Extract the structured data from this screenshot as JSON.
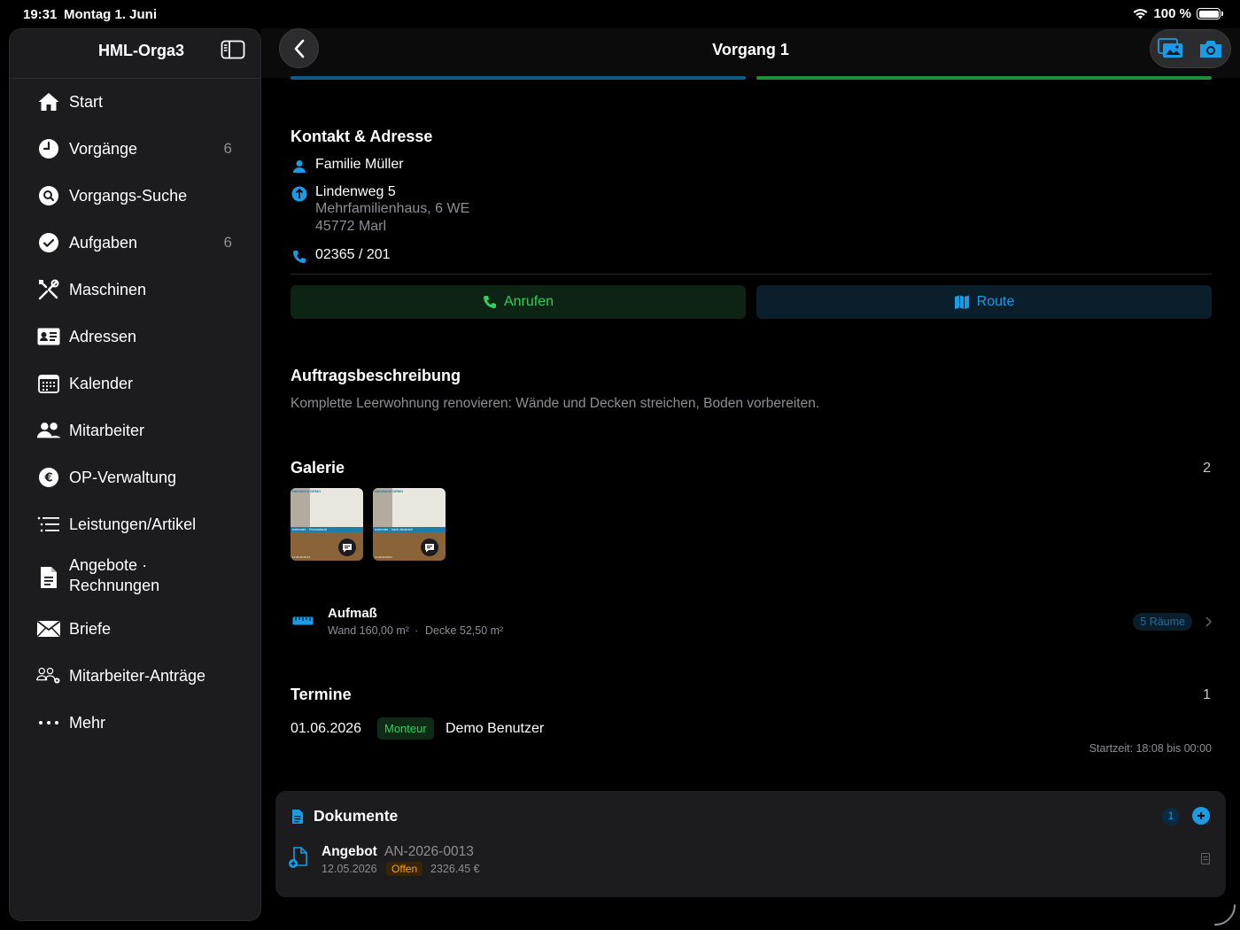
{
  "status": {
    "time": "19:31",
    "date": "Montag 1. Juni",
    "battery": "100 %"
  },
  "sidebar": {
    "title": "HML-Orga3",
    "items": [
      {
        "label": "Start",
        "icon": "house-icon",
        "count": ""
      },
      {
        "label": "Vorgänge",
        "icon": "clock-icon",
        "count": "6"
      },
      {
        "label": "Vorgangs-Suche",
        "icon": "search-icon",
        "count": ""
      },
      {
        "label": "Aufgaben",
        "icon": "checkmark-icon",
        "count": "6"
      },
      {
        "label": "Maschinen",
        "icon": "tools-icon",
        "count": ""
      },
      {
        "label": "Adressen",
        "icon": "contact-card-icon",
        "count": ""
      },
      {
        "label": "Kalender",
        "icon": "calendar-icon",
        "count": ""
      },
      {
        "label": "Mitarbeiter",
        "icon": "people-icon",
        "count": ""
      },
      {
        "label": "OP-Verwaltung",
        "icon": "euro-icon",
        "count": ""
      },
      {
        "label": "Leistungen/Artikel",
        "icon": "list-icon",
        "count": ""
      },
      {
        "label": "Angebote ·",
        "label2": "Rechnungen",
        "icon": "document-icon",
        "count": ""
      },
      {
        "label": "Briefe",
        "icon": "envelope-icon",
        "count": ""
      },
      {
        "label": "Mitarbeiter-Anträge",
        "icon": "people-gear-icon",
        "count": ""
      },
      {
        "label": "Mehr",
        "icon": "ellipsis-icon",
        "count": ""
      }
    ]
  },
  "header": {
    "title": "Vorgang 1"
  },
  "contact": {
    "title": "Kontakt & Adresse",
    "name": "Familie Müller",
    "street": "Lindenweg 5",
    "building": "Mehrfamilienhaus, 6 WE",
    "city": "45772 Marl",
    "phone": "02365 / 201",
    "call_label": "Anrufen",
    "route_label": "Route"
  },
  "description": {
    "title": "Auftragsbeschreibung",
    "text": "Komplette Leerwohnung renovieren: Wände und Decken streichen, Boden vorbereiten."
  },
  "gallery": {
    "title": "Galerie",
    "count": "2",
    "images": [
      {
        "caption_top": "Handwerk DEMO",
        "caption_band": "nzimmer - Vorzustand",
        "caption_bottom": "12.06.26 09:21"
      },
      {
        "caption_top": "Handwerk DEMO",
        "caption_band": "nzimmer - nach Anstrich",
        "caption_bottom": "12.06.26 09:21"
      }
    ]
  },
  "aufmass": {
    "title": "Aufmaß",
    "wall": "Wand 160,00 m²",
    "separator": "·",
    "ceiling": "Decke 52,50 m²",
    "rooms_badge": "5 Räume"
  },
  "termine": {
    "title": "Termine",
    "count": "1",
    "date": "01.06.2026",
    "role": "Monteur",
    "person": "Demo Benutzer",
    "time": "Startzeit: 18:08 bis 00:00"
  },
  "documents": {
    "title": "Dokumente",
    "count": "1",
    "item": {
      "type": "Angebot",
      "number": "AN-2026-0013",
      "date": "12.05.2026",
      "status": "Offen",
      "amount": "2326.45 €"
    }
  },
  "colors": {
    "accent_blue": "#1a9be6",
    "accent_green": "#30d158",
    "call_bg": "#0d2414",
    "route_bg": "#0b1e2c",
    "status_orange": "#ff9f0a"
  }
}
